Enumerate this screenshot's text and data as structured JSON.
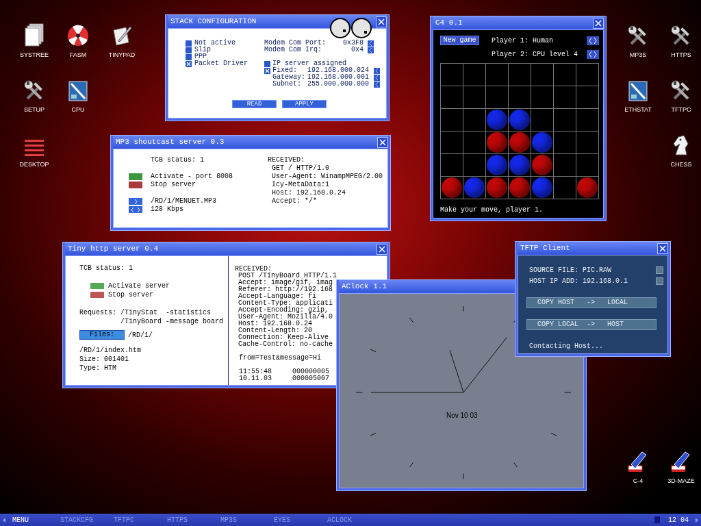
{
  "desktop_icons": [
    {
      "label": "SYSTREE",
      "kind": "documents"
    },
    {
      "label": "FASM",
      "kind": "hazard"
    },
    {
      "label": "TINYPAD",
      "kind": "editor"
    },
    {
      "label": "SETUP",
      "kind": "tools"
    },
    {
      "label": "CPU",
      "kind": "monitor"
    },
    {
      "label": "DESKTOP",
      "kind": "lines"
    },
    {
      "label": "MP3S",
      "kind": "tools"
    },
    {
      "label": "HTTPS",
      "kind": "tools"
    },
    {
      "label": "ETHSTAT",
      "kind": "monitor"
    },
    {
      "label": "TFTPC",
      "kind": "tools"
    },
    {
      "label": "CHESS",
      "kind": "knight"
    },
    {
      "label": "C-4",
      "kind": "pencil"
    },
    {
      "label": "3D-MAZE",
      "kind": "pencil"
    }
  ],
  "stack_config": {
    "title": "STACK CONFIGURATION",
    "interfaces": [
      {
        "label": "Not active",
        "checked": false
      },
      {
        "label": "Slip",
        "checked": false
      },
      {
        "label": "PPP",
        "checked": false
      },
      {
        "label": "Packet Driver",
        "checked": true
      }
    ],
    "modem": [
      {
        "label": "Modem Com Port:",
        "value": "0x3F8"
      },
      {
        "label": "Modem Com Irq:",
        "value": "0x4"
      }
    ],
    "ip_server": {
      "label": "IP server assigned",
      "checked": false
    },
    "fixed": {
      "label": "Fixed:",
      "value": "192.168.000.024",
      "checked": true
    },
    "ip_fields": [
      {
        "label": "Gateway:",
        "value": "192.168.000.001"
      },
      {
        "label": "Subnet:",
        "value": "255.000.000.000"
      }
    ],
    "buttons": [
      "READ",
      "APPLY"
    ]
  },
  "mp3_server": {
    "title": "MP3 shoutcast server 0.3",
    "tcb_status": "TCB status: 1",
    "actions": [
      {
        "label": "Activate - port 8008",
        "color": "#3f9640"
      },
      {
        "label": "Stop server",
        "color": "#a83c3c"
      }
    ],
    "file": "/RD/1/MENUET.MP3",
    "bitrate": "128 Kbps",
    "received_title": "RECEIVED:",
    "received": [
      "GET / HTTP/1.0",
      "User-Agent: WinampMPEG/2.00",
      "Icy-MetaData:1",
      "Host: 192.168.0.24",
      "Accept: */*"
    ]
  },
  "http_server": {
    "title": "Tiny http server 0.4",
    "tcb_status": "TCB status: 1",
    "actions": [
      {
        "label": "Activate server",
        "color": "#55a855"
      },
      {
        "label": "Stop server",
        "color": "#c05555"
      }
    ],
    "requests_label": "Requests:",
    "requests": [
      "/TinyStat  -statistics",
      "/TinyBoard -message board"
    ],
    "files_button": "Files:",
    "files_path": "/RD/1/",
    "file_info": [
      "/RD/1/index.htm",
      "Size: 001401",
      "Type: HTM"
    ],
    "received_title": "RECEIVED:",
    "received": [
      "POST /TinyBoard HTTP/1.1",
      "Accept: image/gif, imag",
      "Referer: http://192.168",
      "Accept-Language: fi",
      "Content-Type: applicati",
      "Accept-Encoding: gzip,",
      "User-Agent: Mozilla/4.0",
      "Host: 192.168.0.24",
      "Content-Length: 20",
      "Connection: Keep-Alive",
      "Cache-Control: no-cache"
    ],
    "message": "from=Test&message=Hi",
    "log": [
      [
        "11:55:48",
        "000000005"
      ],
      [
        "10.11.03",
        "000005007"
      ]
    ]
  },
  "c4": {
    "title": "C4 0.1",
    "new_game": "New game",
    "players": [
      "Player 1: Human",
      "Player 2: CPU level 4"
    ],
    "board": [
      [
        {
          "empty": true
        },
        {
          "empty": true
        },
        {
          "empty": true
        },
        {
          "empty": true
        },
        {
          "empty": true
        },
        {
          "empty": true
        },
        {
          "empty": true
        }
      ],
      [
        {
          "empty": true
        },
        {
          "empty": true
        },
        {
          "empty": true
        },
        {
          "empty": true
        },
        {
          "empty": true
        },
        {
          "empty": true
        },
        {
          "empty": true
        }
      ],
      [
        {
          "empty": true
        },
        {
          "empty": true
        },
        {
          "empty": false,
          "color": "#1428e8"
        },
        {
          "empty": false,
          "color": "#1428e8"
        },
        {
          "empty": true
        },
        {
          "empty": true
        },
        {
          "empty": true
        }
      ],
      [
        {
          "empty": true
        },
        {
          "empty": true
        },
        {
          "empty": false,
          "color": "#c00808"
        },
        {
          "empty": false,
          "color": "#c00808"
        },
        {
          "empty": false,
          "color": "#1428e8"
        },
        {
          "empty": true
        },
        {
          "empty": true
        }
      ],
      [
        {
          "empty": true
        },
        {
          "empty": true
        },
        {
          "empty": false,
          "color": "#1428e8"
        },
        {
          "empty": false,
          "color": "#1428e8"
        },
        {
          "empty": false,
          "color": "#c00808"
        },
        {
          "empty": true
        },
        {
          "empty": true
        }
      ],
      [
        {
          "empty": false,
          "color": "#c00808"
        },
        {
          "empty": false,
          "color": "#1428e8"
        },
        {
          "empty": false,
          "color": "#c00808"
        },
        {
          "empty": false,
          "color": "#c00808"
        },
        {
          "empty": false,
          "color": "#1428e8"
        },
        {
          "empty": true
        },
        {
          "empty": false,
          "color": "#c00808"
        }
      ]
    ],
    "status": "Make your move, player 1."
  },
  "clock": {
    "title": "AClock 1.1",
    "date": "Nov 10 03"
  },
  "tftp": {
    "title": "TFTP Client",
    "fields": [
      "SOURCE FILE: PIC.RAW",
      "HOST IP ADD: 192.168.0.1"
    ],
    "buttons": [
      "COPY HOST   ->   LOCAL",
      "COPY LOCAL  ->   HOST"
    ],
    "status": "Contacting Host..."
  },
  "taskbar": {
    "menu": "MENU",
    "tasks": [
      "STACKCFG",
      "TFTPC",
      "HTTPS",
      "MP3S",
      "EYES",
      "ACLOCK"
    ],
    "time": "12 04"
  }
}
